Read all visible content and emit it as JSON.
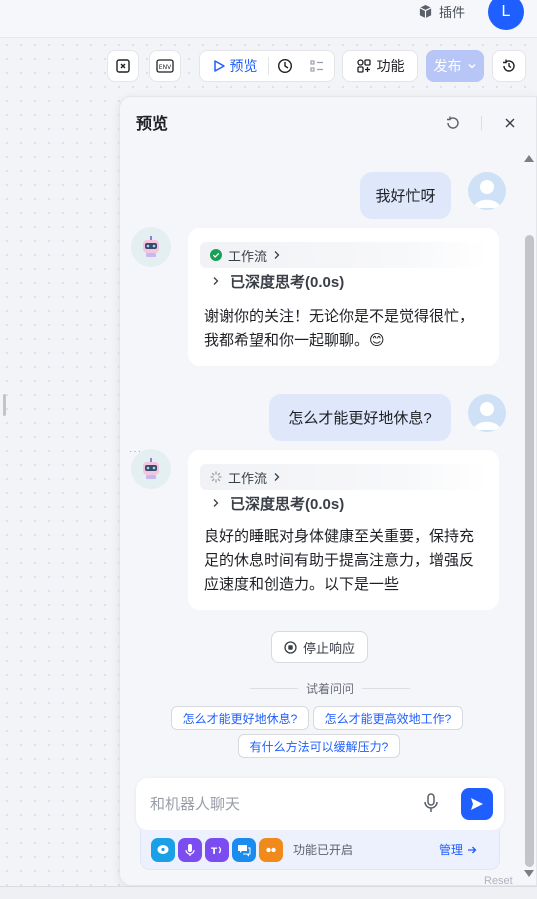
{
  "topbar": {
    "plugin_label": "插件",
    "user_initial": "L"
  },
  "toolbar": {
    "preview_label": "预览",
    "features_label": "功能",
    "publish_label": "发布"
  },
  "panel": {
    "title": "预览",
    "messages": [
      {
        "role": "user",
        "text": "我好忙呀"
      },
      {
        "role": "bot",
        "workflow_label": "工作流",
        "workflow_status": "done",
        "thinking_label": "已深度思考(0.0s)",
        "answer_lines": [
          "谢谢你的关注！无论你是不是觉得很忙，",
          "我都希望和你一起聊聊。😊"
        ]
      },
      {
        "role": "user",
        "text": "怎么才能更好地休息?"
      },
      {
        "role": "bot",
        "workflow_label": "工作流",
        "workflow_status": "loading",
        "thinking_label": "已深度思考(0.0s)",
        "answer_lines": [
          "良好的睡眠对身体健康至关重要，保持充",
          "足的休息时间有助于提高注意力，增强反",
          "应速度和创造力。以下是一些"
        ]
      }
    ],
    "stop_label": "停止响应",
    "try_ask_label": "试着问问",
    "suggestions": [
      "怎么才能更好地休息?",
      "怎么才能更高效地工作?",
      "有什么方法可以缓解压力?"
    ],
    "input_placeholder": "和机器人聊天",
    "feature_status": "功能已开启",
    "manage_label": "管理"
  },
  "canvas": {
    "reset_flow_label": "Reset Flow"
  },
  "colors": {
    "accent": "#1f5eff",
    "user_bubble": "#dfe8fb",
    "publish_disabled": "#b8c6f7"
  },
  "feature_icons": [
    {
      "name": "chat-plugin-icon",
      "color": "#1aa0e6"
    },
    {
      "name": "voice-icon",
      "color": "#7b4df0"
    },
    {
      "name": "text-to-speech-icon",
      "color": "#7b4df0"
    },
    {
      "name": "message-icon",
      "color": "#1a8cf0"
    },
    {
      "name": "quote-icon",
      "color": "#f08a1a"
    }
  ]
}
